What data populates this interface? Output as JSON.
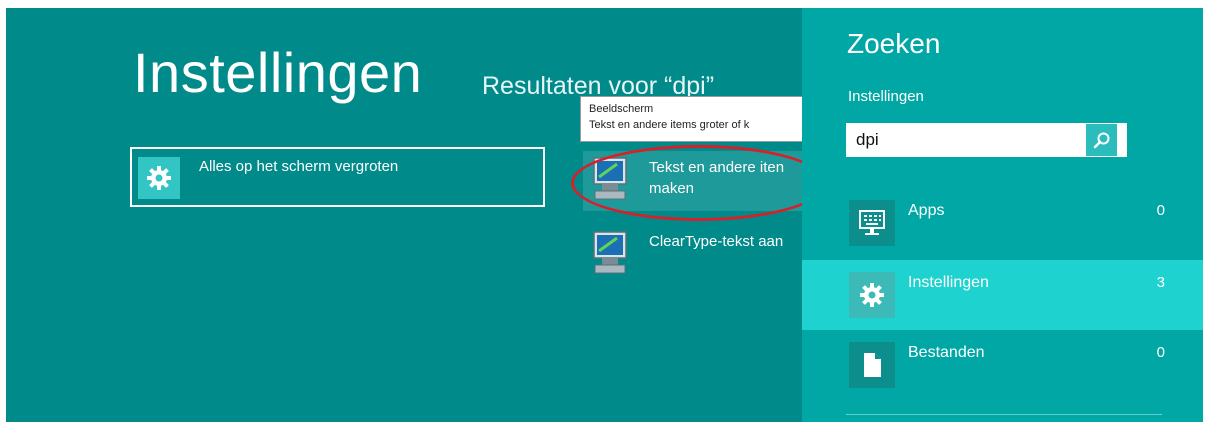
{
  "main": {
    "title": "Instellingen",
    "results_heading": "Resultaten voor “dpi”",
    "results": [
      {
        "label": "Alles op het scherm vergroten",
        "icon": "gear-icon"
      },
      {
        "label": "Tekst en andere iten\nmaken",
        "icon": "monitor-icon"
      },
      {
        "label": "ClearType-tekst aan",
        "icon": "monitor-icon"
      }
    ],
    "tooltip": {
      "title": "Beeldscherm",
      "text": "Tekst en andere items groter of k"
    }
  },
  "charm": {
    "title": "Zoeken",
    "scope": "Instellingen",
    "search_value": "dpi",
    "clear_glyph": "✕",
    "categories": [
      {
        "label": "Apps",
        "count": "0",
        "icon": "keyboard-monitor-icon"
      },
      {
        "label": "Instellingen",
        "count": "3",
        "icon": "gear-icon",
        "selected": true
      },
      {
        "label": "Bestanden",
        "count": "0",
        "icon": "document-icon"
      }
    ]
  },
  "colors": {
    "background": "#008a8a",
    "charm_background": "#00a7a5",
    "selected_category": "#1ed2cf",
    "highlight_ellipse": "#d6202a"
  }
}
